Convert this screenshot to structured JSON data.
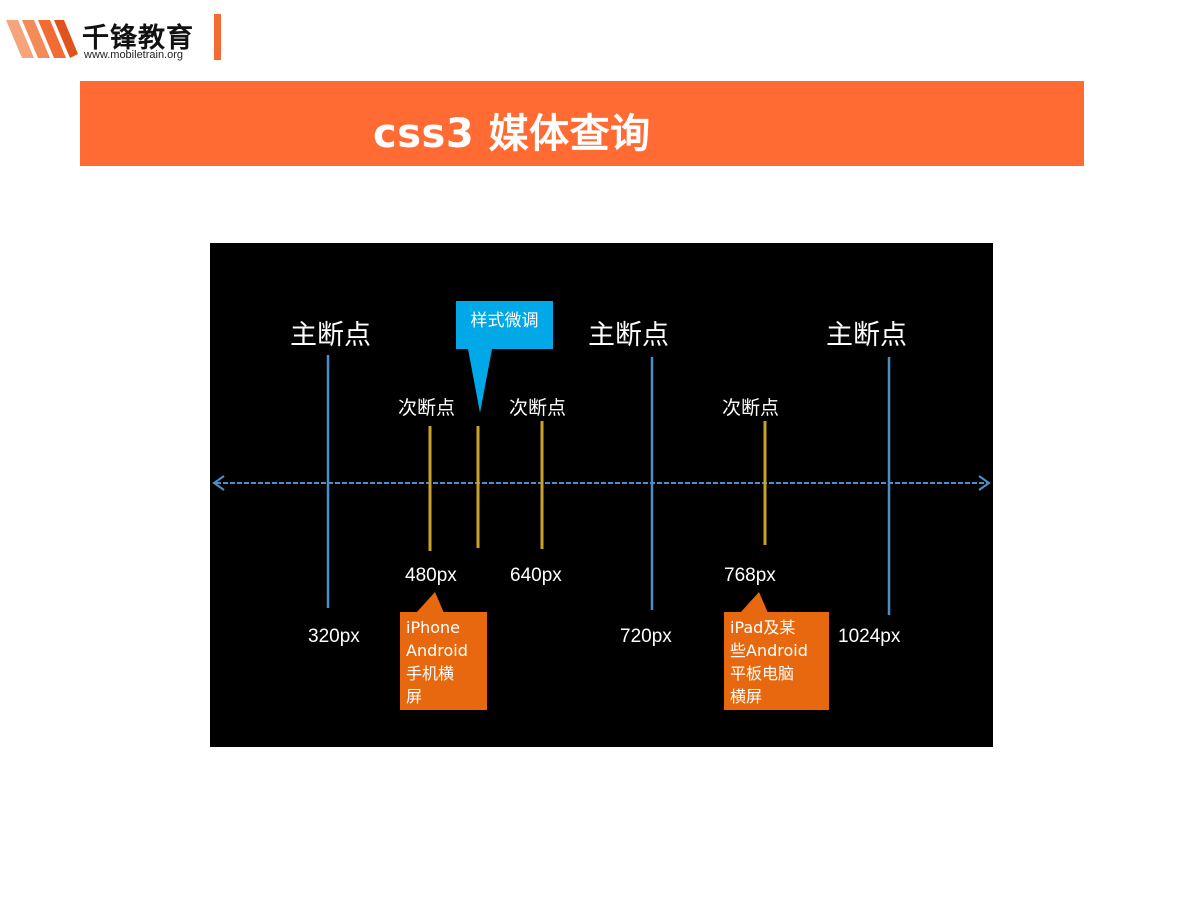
{
  "logo": {
    "name_cn": "千锋教育",
    "url": "www.mobiletrain.org",
    "brand_color": "#f26b32"
  },
  "banner": {
    "title": "css3 媒体查询",
    "color": "#ff6b33"
  },
  "diagram": {
    "main_breakpoint_label": "主断点",
    "sub_breakpoint_label": "次断点",
    "style_tweak_callout": "样式微调",
    "main_breakpoints": [
      "320px",
      "720px",
      "1024px"
    ],
    "sub_breakpoints": [
      "480px",
      "640px",
      "768px"
    ],
    "callout_phone": "iPhone\nAndroid\n手机横\n屏",
    "callout_tablet": "iPad及某\n些Android\n平板电脑\n横屏",
    "colors": {
      "main_line": "#4a8fc9",
      "sub_line": "#c9a227",
      "callout_blue": "#00a8e8",
      "callout_orange": "#e8680f",
      "background": "#000000"
    }
  }
}
